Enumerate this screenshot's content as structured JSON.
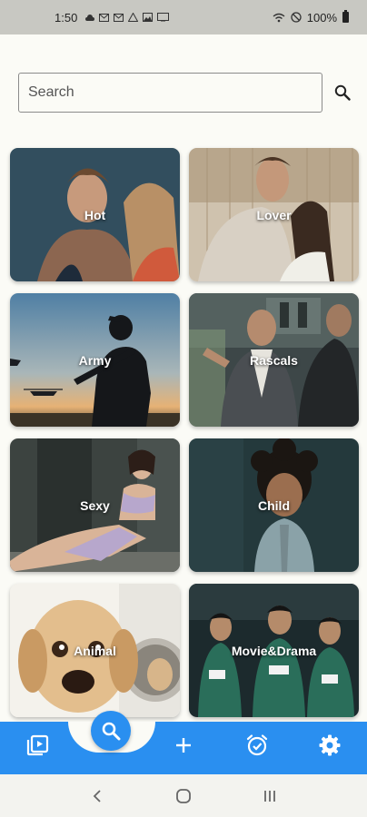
{
  "status_bar": {
    "time": "1:50",
    "battery": "100%",
    "left_icons": [
      "cloud-icon",
      "mail-icon",
      "mail-icon",
      "warning-icon",
      "image-icon",
      "cast-icon"
    ],
    "right_icons": [
      "wifi-icon",
      "do-not-disturb-icon",
      "battery-icon"
    ]
  },
  "search": {
    "placeholder": "Search"
  },
  "categories": [
    {
      "label": "Hot"
    },
    {
      "label": "Lover"
    },
    {
      "label": "Army"
    },
    {
      "label": "Rascals"
    },
    {
      "label": "Sexy"
    },
    {
      "label": "Child"
    },
    {
      "label": "Animal"
    },
    {
      "label": "Movie&Drama"
    }
  ],
  "bottom_nav": {
    "items": [
      "video-library-icon",
      "search-icon",
      "add-icon",
      "alarm-icon",
      "settings-icon"
    ],
    "accent_color": "#2a8ff0"
  },
  "system_nav": [
    "back-icon",
    "home-icon",
    "recents-icon"
  ]
}
